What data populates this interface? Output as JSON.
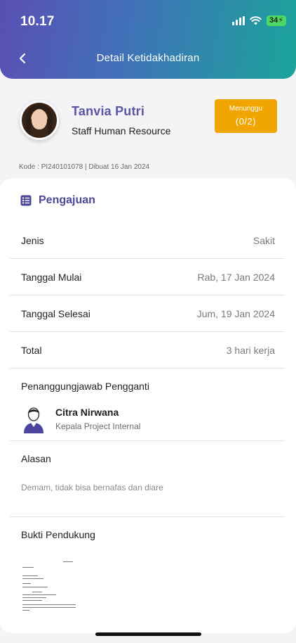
{
  "status_bar": {
    "time": "10.17",
    "battery": "34"
  },
  "header": {
    "title": "Detail Ketidakhadiran"
  },
  "profile": {
    "name": "Tanvia Putri",
    "position": "Staff Human Resource",
    "status_label": "Menunggu",
    "status_count": "(0/2)",
    "code_line": "Kode : PI240101078 | Dibuat 16 Jan 2024"
  },
  "section": {
    "title": "Pengajuan"
  },
  "details": [
    {
      "label": "Jenis",
      "value": "Sakit"
    },
    {
      "label": "Tanggal Mulai",
      "value": "Rab, 17 Jan 2024"
    },
    {
      "label": "Tanggal Selesai",
      "value": "Jum, 19 Jan 2024"
    },
    {
      "label": "Total",
      "value": "3 hari kerja"
    }
  ],
  "replacement": {
    "title": "Penanggungjawab Pengganti",
    "name": "Citra Nirwana",
    "role": "Kepala Project Internal"
  },
  "reason": {
    "title": "Alasan",
    "text": "Demam, tidak bisa bernafas dan diare"
  },
  "evidence": {
    "title": "Bukti Pendukung"
  },
  "colors": {
    "accent": "#5b55a8",
    "status_waiting": "#f0a500",
    "header_gradient_start": "#5a4fb3",
    "header_gradient_end": "#1aa49a"
  }
}
